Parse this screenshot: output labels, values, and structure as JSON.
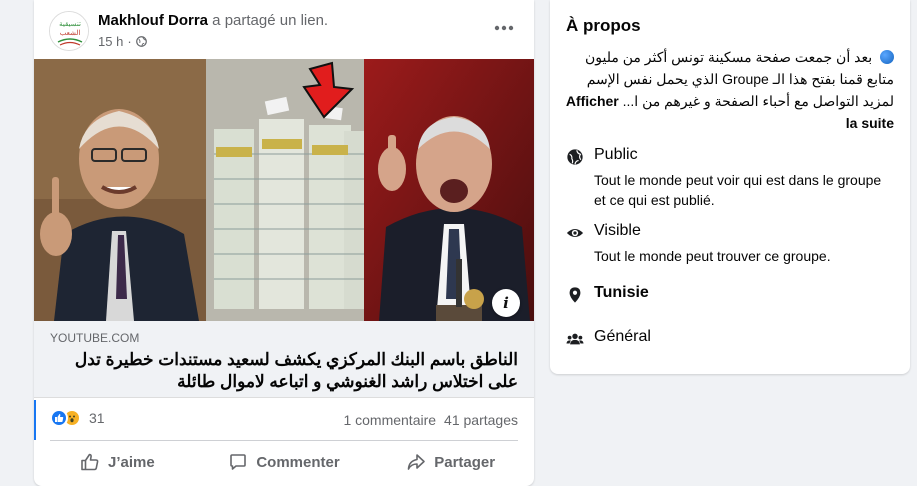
{
  "post": {
    "author": "Makhlouf Dorra",
    "action_text": " a partagé un lien.",
    "time": "15 h",
    "dot": "·",
    "avatar_text": "تنسيقية الشعب",
    "link": {
      "domain": "YOUTUBE.COM",
      "title": "الناطق باسم البنك المركزي يكشف لسعيد مستندات خطيرة تدل على اختلاس راشد الغنوشي و اتباعه لاموال طائلة"
    },
    "info_button": "i",
    "reactions_count": "31",
    "comments": "1 commentaire",
    "shares": "41 partages",
    "actions": {
      "like": "J’aime",
      "comment": "Commenter",
      "share": "Partager"
    }
  },
  "about": {
    "title": "À propos",
    "description": "بعد أن جمعت صفحة مسكينة تونس أكثر من مليون متابع قمنا بفتح هذا الـ Groupe الذي يحمل نفس الإسم لمزيد التواصل مع أحباء الصفحة و غيرهم من ا...",
    "see_more": "Afficher la suite",
    "public": {
      "title": "Public",
      "text": "Tout le monde peut voir qui est dans le groupe et ce qui est publié."
    },
    "visible": {
      "title": "Visible",
      "text": "Tout le monde peut trouver ce groupe."
    },
    "location": "Tunisie",
    "category": "Général"
  },
  "colors": {
    "accent": "#1877f2",
    "secondary_text": "#65676b",
    "background": "#f0f2f5"
  }
}
